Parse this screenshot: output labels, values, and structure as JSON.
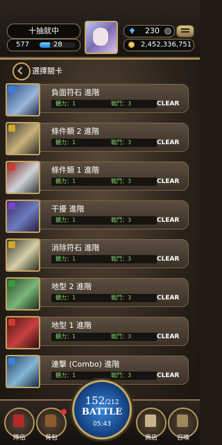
{
  "hud": {
    "status_text": "十抽就中",
    "level": "577",
    "exp_percent": 28,
    "exp_text": "28",
    "gems": "230",
    "coins": "2,452,336,751"
  },
  "stage_header": {
    "title": "選擇關卡"
  },
  "stages": [
    {
      "name": "負面符石 進階",
      "hp_label": "體力：1",
      "battles_label": "戰鬥：3",
      "status": "CLEAR",
      "element_color": "#3c7ed6",
      "element_icon": "water-icon"
    },
    {
      "name": "條件類 2 進階",
      "hp_label": "體力：1",
      "battles_label": "戰鬥：3",
      "status": "CLEAR",
      "element_color": "#d4a829",
      "element_icon": "light-icon"
    },
    {
      "name": "條件類 1 進階",
      "hp_label": "體力：1",
      "battles_label": "戰鬥：3",
      "status": "CLEAR",
      "element_color": "#d2392d",
      "element_icon": "fire-icon"
    },
    {
      "name": "干擾 進階",
      "hp_label": "體力：1",
      "battles_label": "戰鬥：3",
      "status": "CLEAR",
      "element_color": "#7b3fc8",
      "element_icon": "dark-icon"
    },
    {
      "name": "消除符石 進階",
      "hp_label": "體力：1",
      "battles_label": "戰鬥：3",
      "status": "CLEAR",
      "element_color": "#d4a829",
      "element_icon": "light-icon"
    },
    {
      "name": "地型 2 進階",
      "hp_label": "體力：1",
      "battles_label": "戰鬥：3",
      "status": "CLEAR",
      "element_color": "#3b9a3b",
      "element_icon": "wood-icon"
    },
    {
      "name": "地型 1 進階",
      "hp_label": "體力：1",
      "battles_label": "戰鬥：3",
      "status": "CLEAR",
      "element_color": "#d2392d",
      "element_icon": "fire-icon"
    },
    {
      "name": "連擊 (Combo) 進階",
      "hp_label": "體力：1",
      "battles_label": "戰鬥：3",
      "status": "CLEAR",
      "element_color": "#3c7ed6",
      "element_icon": "water-icon"
    }
  ],
  "nav": {
    "team": "隊伍",
    "bag": "背包",
    "stamina": "152",
    "stamina_max": "/212",
    "battle": "BATTLE",
    "timer": "05:43",
    "shop": "商店",
    "summon": "召喚"
  }
}
